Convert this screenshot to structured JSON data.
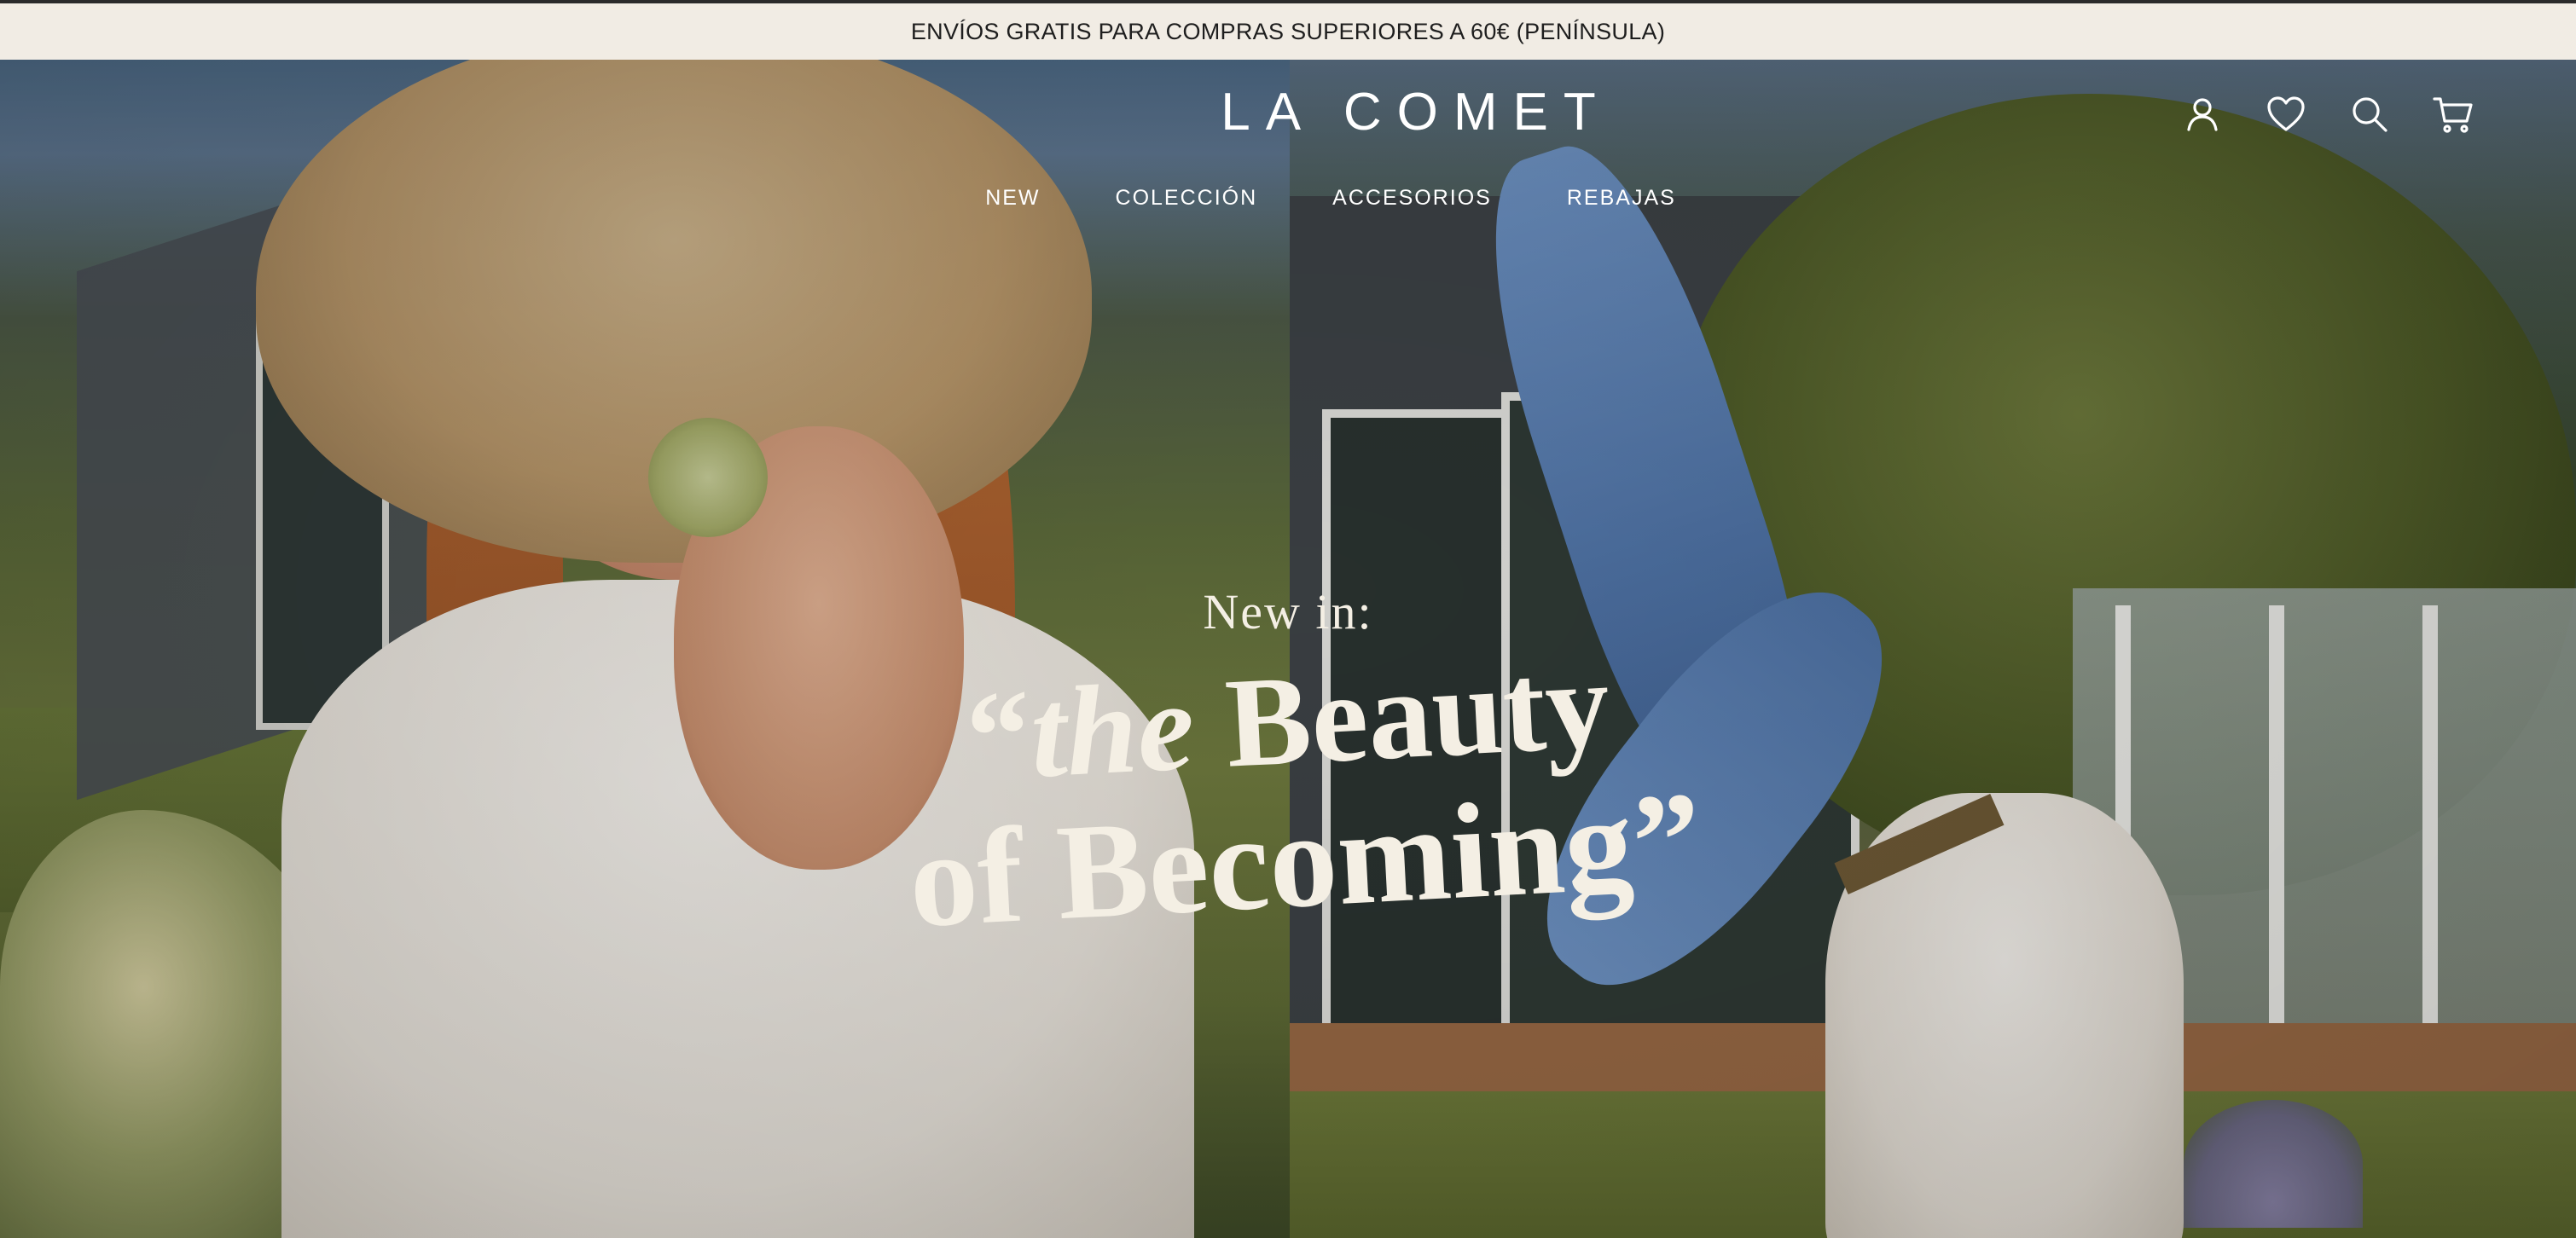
{
  "announcement": {
    "text": "ENVÍOS GRATIS PARA COMPRAS SUPERIORES A 60€ (PENÍNSULA)"
  },
  "header": {
    "logo": "LA COMET",
    "nav": [
      {
        "label": "NEW"
      },
      {
        "label": "COLECCIÓN"
      },
      {
        "label": "ACCESORIOS"
      },
      {
        "label": "REBAJAS"
      }
    ],
    "icons": [
      "account-icon",
      "wishlist-heart-icon",
      "search-icon",
      "cart-icon"
    ]
  },
  "hero": {
    "eyebrow": "New in:",
    "headline_line1_open": "“",
    "headline_line1_italic": "the",
    "headline_line1_rest": " Beauty",
    "headline_line2": "of Becoming”"
  },
  "colors": {
    "announcement_bg": "#f1ece4",
    "announcement_text": "#1e1e1e",
    "hero_text": "#f4efe4",
    "header_text": "#ffffff"
  }
}
